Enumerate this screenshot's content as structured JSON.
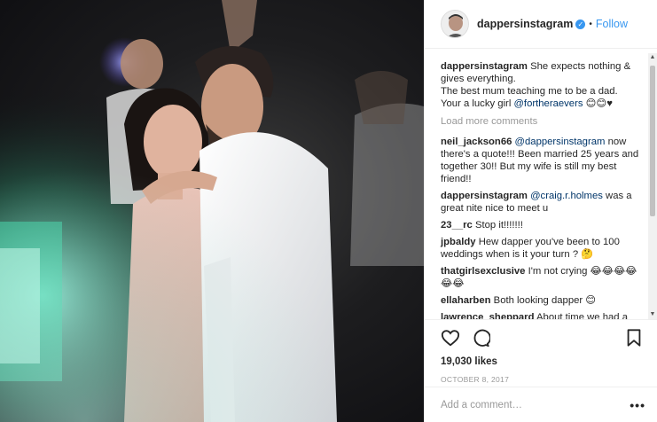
{
  "post": {
    "photo_icon": "wedding-couple-photo"
  },
  "header": {
    "username": "dappersinstagram",
    "verified_icon": "verified-badge-icon",
    "dot": "•",
    "follow_label": "Follow"
  },
  "caption": {
    "user": "dappersinstagram",
    "text": "She expects nothing & gives everything.",
    "line2": "The best mum teaching me to be a dad.",
    "line3": "Your a lucky girl",
    "mention": "@fortheraevers",
    "emoji": "😊😊♥"
  },
  "load_more": "Load more comments",
  "comments": [
    {
      "user": "neil_jackson66",
      "mention": "@dappersinstagram",
      "text": "now there's a quote!!! Been married 25 years and together 30!! But my wife is still my best friend!!"
    },
    {
      "user": "dappersinstagram",
      "mention": "@craig.r.holmes",
      "text": "was a great nite nice to meet u"
    },
    {
      "user": "23__rc",
      "mention": "",
      "text": "Stop it!!!!!!!"
    },
    {
      "user": "jpbaldy",
      "mention": "",
      "text": "Hew dapper you've been to 100 weddings when is it your turn ? 🤔"
    },
    {
      "user": "thatgirlsexclusive",
      "mention": "",
      "text": "I'm not crying 😂😂😂😂😂😂"
    },
    {
      "user": "ellaharben",
      "mention": "",
      "text": "Both looking dapper 😊"
    },
    {
      "user": "lawrence_sheppard",
      "mention": "",
      "text": "About time we had a"
    }
  ],
  "actions": {
    "like_icon": "heart-icon",
    "comment_icon": "comment-icon",
    "save_icon": "bookmark-icon",
    "likes": "19,030 likes",
    "date": "OCTOBER 8, 2017"
  },
  "add_comment": {
    "placeholder": "Add a comment…",
    "more": "•••"
  },
  "colors": {
    "link": "#3897f0",
    "mention": "#003569",
    "muted": "#999999"
  }
}
